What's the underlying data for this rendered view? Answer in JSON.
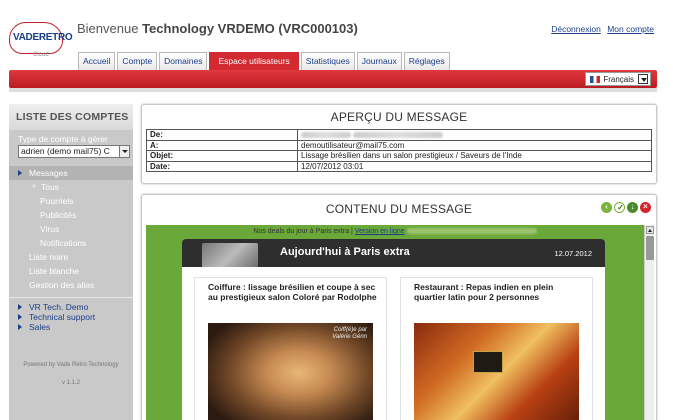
{
  "header": {
    "logo": {
      "text_main": "VADERETRO",
      "text_sub": "Cloud"
    },
    "welcome_prefix": "Bienvenue ",
    "welcome_bold": "Technology VRDEMO (VRC000103)",
    "links": {
      "logout": "Déconnexion",
      "account": "Mon compte"
    },
    "tabs": [
      {
        "label": "Accueil",
        "active": false
      },
      {
        "label": "Compte",
        "active": false
      },
      {
        "label": "Domaines",
        "active": false
      },
      {
        "label": "Espace utilisateurs",
        "active": true
      },
      {
        "label": "Statistiques",
        "active": false
      },
      {
        "label": "Journaux",
        "active": false
      },
      {
        "label": "Réglages",
        "active": false
      }
    ],
    "language": "Français",
    "accent_color": "#d22a30"
  },
  "sidebar": {
    "title": "LISTE DES COMPTES",
    "type_label": "Type de compte à gérer",
    "type_value": "adrien (demo mail75) C",
    "menu": [
      {
        "label": "Messages",
        "level": 0,
        "selected": true
      },
      {
        "label": "Tous",
        "level": 1
      },
      {
        "label": "Pourriels",
        "level": 2
      },
      {
        "label": "Publicités",
        "level": 2
      },
      {
        "label": "Virus",
        "level": 2
      },
      {
        "label": "Notifications",
        "level": 2
      },
      {
        "label": "Liste noire",
        "level": 0
      },
      {
        "label": "Liste blanche",
        "level": 0
      },
      {
        "label": "Gestion des alias",
        "level": 0
      }
    ],
    "links": [
      {
        "label": "VR Tech. Demo"
      },
      {
        "label": "Technical support"
      },
      {
        "label": "Sales"
      }
    ],
    "powered": "Powered by Vade Retro Technology",
    "version": "v 1.1.2"
  },
  "preview": {
    "title": "APERÇU DU MESSAGE",
    "rows": [
      {
        "key": "De:",
        "value": ""
      },
      {
        "key": "A:",
        "value": "demoutilisateur@mail75.com"
      },
      {
        "key": "Objet:",
        "value": "Lissage brésilien dans un salon prestigieux / Saveurs de l'Inde"
      },
      {
        "key": "Date:",
        "value": "12/07/2012 03:01"
      }
    ]
  },
  "content": {
    "title": "CONTENU DU MESSAGE",
    "actions": [
      "back-icon",
      "approve-icon",
      "download-icon",
      "delete-icon"
    ],
    "email": {
      "top_text": "Nos deals du jour à Paris extra |",
      "top_link": "Version en ligne",
      "banner_title": "Aujourd'hui à Paris extra",
      "banner_date": "12.07.2012",
      "deals": [
        {
          "title": "Coiffure : lissage brésilien et coupe à sec au prestigieux salon Coloré par Rodolphe",
          "image_caption": "Coiff(é)e par\nValérie Génn"
        },
        {
          "title": "Restaurant : Repas indien en plein quartier latin pour 2 personnes",
          "image_caption": ""
        }
      ]
    },
    "email_bg_color": "#6aa83a"
  }
}
